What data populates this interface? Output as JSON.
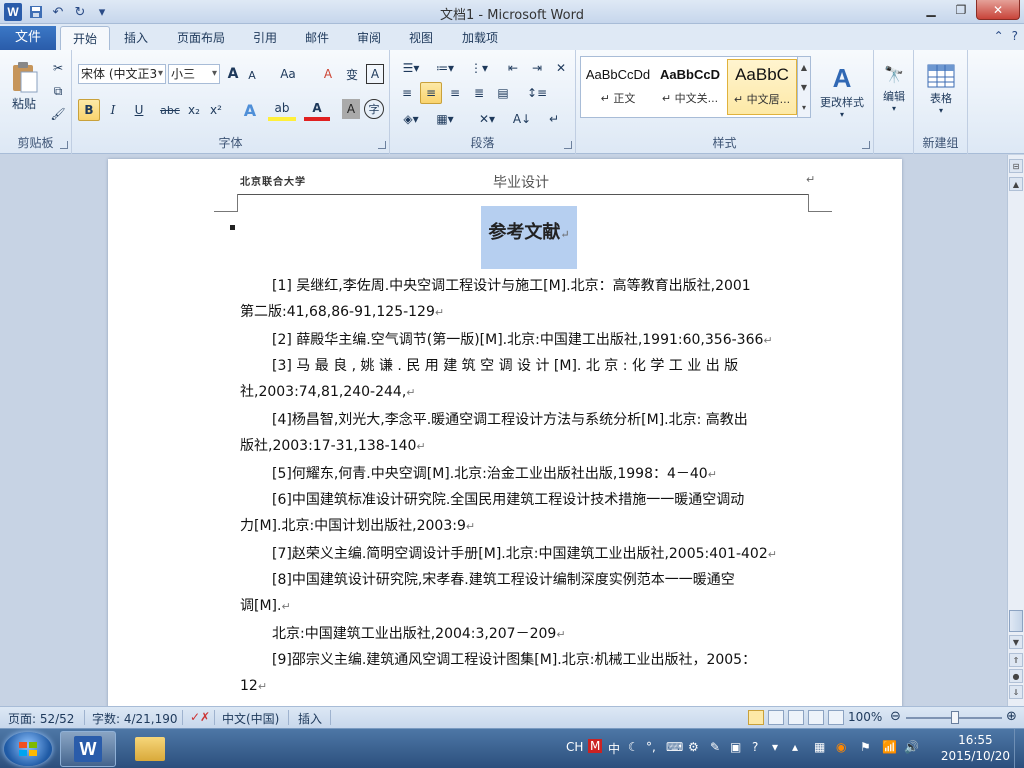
{
  "window": {
    "title": "文档1  -  Microsoft Word",
    "app_icon": "W"
  },
  "quick_access": [
    "save-icon",
    "undo-icon",
    "redo-icon",
    "customize-icon"
  ],
  "ribbon_tabs": [
    {
      "label": "文件",
      "active": false
    },
    {
      "label": "开始",
      "active": true
    },
    {
      "label": "插入",
      "active": false
    },
    {
      "label": "页面布局",
      "active": false
    },
    {
      "label": "引用",
      "active": false
    },
    {
      "label": "邮件",
      "active": false
    },
    {
      "label": "审阅",
      "active": false
    },
    {
      "label": "视图",
      "active": false
    },
    {
      "label": "加载项",
      "active": false
    }
  ],
  "ribbon": {
    "clipboard": {
      "group_label": "剪贴板",
      "paste_label": "粘贴"
    },
    "font": {
      "group_label": "字体",
      "font_name": "宋体 (中文正3",
      "font_size": "小三",
      "bold": "B",
      "italic": "I",
      "underline": "U",
      "strike": "abc",
      "sub": "x₂",
      "sup": "x²",
      "grow": "A",
      "shrink": "A",
      "case": "Aa",
      "clear": "A",
      "phonetic": "A",
      "border": "A",
      "highlight": "ab",
      "fontcolor": "A",
      "shade": "A",
      "circle": "字"
    },
    "paragraph": {
      "group_label": "段落"
    },
    "styles": {
      "group_label": "样式",
      "items": [
        {
          "preview": "AaBbCcDd",
          "name": "↵ 正文",
          "selected": false
        },
        {
          "preview": "AaBbCcD",
          "name": "↵ 中文关...",
          "selected": false
        },
        {
          "preview": "AaBbC",
          "name": "↵ 中文居...",
          "selected": true
        }
      ],
      "change_styles_label": "更改样式"
    },
    "editing": {
      "label": "编辑"
    },
    "tables": {
      "label": "表格",
      "group_label": "新建组"
    }
  },
  "document": {
    "header_school": "北京联合大学",
    "header_title": "毕业设计",
    "heading": "参考文献",
    "references": [
      {
        "lines": [
          "[1]  吴继红,李佐周.中央空调工程设计与施工[M].北京：高等教育出版社,2001",
          "第二版:41,68,86-91,125-129"
        ]
      },
      {
        "lines": [
          "[2]  薛殿华主编.空气调节(第一版)[M].北京:中国建工出版社,1991:60,356-366"
        ]
      },
      {
        "lines": [
          "[3] 马 最 良 , 姚 谦 . 民 用 建 筑 空 调 设 计 [M]. 北 京 : 化 学 工 业 出 版",
          "社,2003:74,81,240-244,"
        ]
      },
      {
        "lines": [
          "[4]杨昌智,刘光大,李念平.暖通空调工程设计方法与系统分析[M].北京: 高教出",
          "版社,2003:17-31,138-140"
        ]
      },
      {
        "lines": [
          "[5]何耀东,何青.中央空调[M].北京:治金工业出版社出版,1998：4－40"
        ]
      },
      {
        "lines": [
          "[6]中国建筑标准设计研究院.全国民用建筑工程设计技术措施一一暖通空调动",
          "力[M].北京:中国计划出版社,2003:9"
        ]
      },
      {
        "lines": [
          "[7]赵荣义主编.简明空调设计手册[M].北京:中国建筑工业出版社,2005:401-402"
        ]
      },
      {
        "lines": [
          "[8]中国建筑设计研究院,宋孝春.建筑工程设计编制深度实例范本一一暖通空",
          "调[M]."
        ]
      },
      {
        "lines": [
          "北京:中国建筑工业出版社,2004:3,207－209"
        ]
      },
      {
        "lines": [
          "[9]邵宗义主编.建筑通风空调工程设计图集[M].北京:机械工业出版社，2005：",
          "12"
        ]
      }
    ]
  },
  "status_bar": {
    "page": "页面: 52/52",
    "words": "字数: 4/21,190",
    "language": "中文(中国)",
    "mode": "插入",
    "zoom": "100%",
    "zoom_level": 1.0
  },
  "taskbar": {
    "ime": "CH",
    "ime_mode": "中",
    "time": "16:55",
    "date": "2015/10/20"
  }
}
